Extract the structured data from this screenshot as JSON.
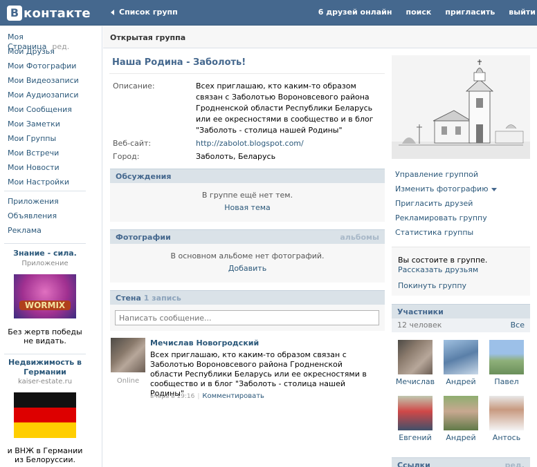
{
  "header": {
    "logo_letter": "В",
    "logo_text": "контакте",
    "back_label": "Список групп",
    "nav": [
      "6 друзей онлайн",
      "поиск",
      "пригласить",
      "выйти"
    ]
  },
  "sidebar": {
    "items": [
      {
        "label": "Моя Страница",
        "edit": "ред."
      },
      {
        "label": "Мои Друзья"
      },
      {
        "label": "Мои Фотографии"
      },
      {
        "label": "Мои Видеозаписи"
      },
      {
        "label": "Мои Аудиозаписи"
      },
      {
        "label": "Мои Сообщения"
      },
      {
        "label": "Мои Заметки"
      },
      {
        "label": "Мои Группы"
      },
      {
        "label": "Мои Встречи"
      },
      {
        "label": "Мои Новости"
      },
      {
        "label": "Мои Настройки"
      }
    ],
    "extra": [
      "Приложения",
      "Объявления",
      "Реклама"
    ],
    "ads": [
      {
        "title": "Знание - сила.",
        "subtitle": "Приложение",
        "image_text": "WORMIX",
        "text": "Без жертв победы не видать."
      },
      {
        "title": "Недвижимость в Германии",
        "subtitle": "kaiser-estate.ru",
        "text": "и ВНЖ в Германии из Белоруссии."
      }
    ]
  },
  "main": {
    "header": "Открытая группа",
    "group_title": "Наша Родина - Заболоть!",
    "info": {
      "description_label": "Описание:",
      "description": "Всех приглашаю, кто каким-то образом связан с Заболотью Вороновсевого района Гродненской области Республики Беларусь или ее окресностями в сообщество и в блог \"Заболоть - столица нашей Родины\"",
      "website_label": "Веб-сайт:",
      "website": "http://zabolot.blogspot.com/",
      "city_label": "Город:",
      "city": "Заболоть, Беларусь"
    },
    "discussions": {
      "title": "Обсуждения",
      "empty": "В группе ещё нет тем.",
      "action": "Новая тема"
    },
    "photos": {
      "title": "Фотографии",
      "right": "альбомы",
      "empty": "В основном альбоме нет фотографий.",
      "action": "Добавить"
    },
    "wall": {
      "title": "Стена",
      "count": "1 запись",
      "placeholder": "Написать сообщение...",
      "post": {
        "author": "Мечислав Новогродский",
        "status": "Online",
        "text": "Всех приглашаю, кто каким-то образом связан с Заболотью Вороновсевого района Гродненской области Республики Беларусь или ее окресностями в сообщество и в блог \"Заболоть - столица нашей Родины\"",
        "time": "вчера в 19:16",
        "comment": "Комментировать"
      }
    }
  },
  "right": {
    "actions": [
      "Управление группой",
      "Изменить фотографию",
      "Пригласить друзей",
      "Рекламировать группу",
      "Статистика группы"
    ],
    "membership": {
      "status": "Вы состоите в группе.",
      "tell": "Рассказать друзьям",
      "leave": "Покинуть группу"
    },
    "members": {
      "title": "Участники",
      "count": "12 человек",
      "all": "Все",
      "list": [
        {
          "name": "Мечислав",
          "color": "#7a6b60"
        },
        {
          "name": "Андрей",
          "color": "#5a7fa8"
        },
        {
          "name": "Павел",
          "color": "#6a8f5a"
        },
        {
          "name": "Евгений",
          "color": "#a55050"
        },
        {
          "name": "Андрей",
          "color": "#7a8f60"
        },
        {
          "name": "Антось",
          "color": "#b89a80"
        }
      ]
    },
    "links": {
      "title": "Ссылки",
      "edit": "ред."
    }
  }
}
